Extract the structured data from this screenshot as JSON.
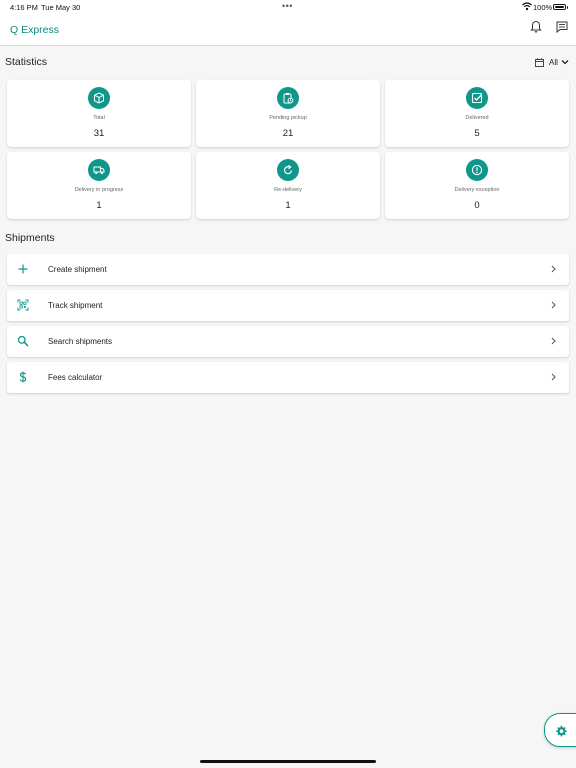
{
  "status_bar": {
    "time": "4:16 PM",
    "date": "Tue May 30",
    "battery": "100%",
    "battery_level": 1.0
  },
  "header": {
    "title": "Q Express",
    "icons": [
      "bell-icon",
      "chat-icon"
    ]
  },
  "statistics": {
    "title": "Statistics",
    "filter_label": "All",
    "cards": [
      {
        "label": "Total",
        "value": "31",
        "icon": "package-icon"
      },
      {
        "label": "Pending pickup",
        "value": "21",
        "icon": "clipboard-clock-icon"
      },
      {
        "label": "Delivered",
        "value": "5",
        "icon": "checkbox-icon"
      },
      {
        "label": "Delivery in progress",
        "value": "1",
        "icon": "truck-icon"
      },
      {
        "label": "Re-delivery",
        "value": "1",
        "icon": "refresh-icon"
      },
      {
        "label": "Delivery exception",
        "value": "0",
        "icon": "exclamation-icon"
      }
    ]
  },
  "shipments": {
    "title": "Shipments",
    "items": [
      {
        "label": "Create shipment",
        "icon": "plus-icon"
      },
      {
        "label": "Track shipment",
        "icon": "qr-scan-icon"
      },
      {
        "label": "Search shipments",
        "icon": "search-icon"
      },
      {
        "label": "Fees calculator",
        "icon": "dollar-icon"
      }
    ]
  },
  "colors": {
    "accent": "#0e978a",
    "title": "#0d8a80",
    "background": "#f6f6f6"
  }
}
